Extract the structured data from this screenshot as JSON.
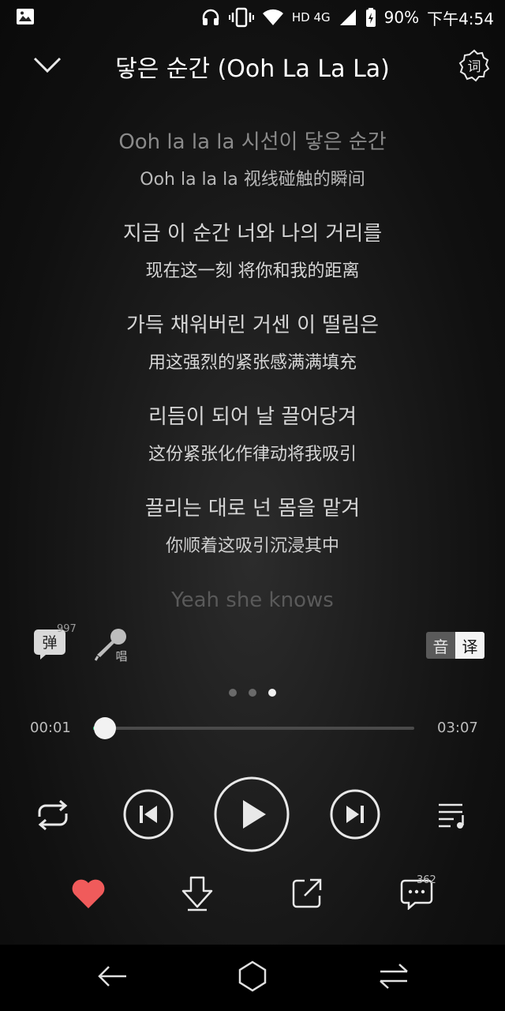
{
  "status_bar": {
    "hd_label": "HD 4G",
    "battery": "90%",
    "time": "下午4:54",
    "icons": [
      "gallery-icon",
      "headset-icon",
      "vibrate-icon",
      "wifi-icon",
      "signal-icon",
      "battery-charging-icon"
    ]
  },
  "header": {
    "title": "닿은 순간 (Ooh La La La)",
    "collapse_icon": "chevron-down-icon",
    "lyrics_mode_icon": "lyrics-settings-icon",
    "lyrics_mode_label": "词"
  },
  "lyrics": [
    {
      "primary": "Ooh la la la 시선이 닿은 순간",
      "secondary": "Ooh la la la 视线碰触的瞬间"
    },
    {
      "primary": "지금 이 순간 너와 나의 거리를",
      "secondary": "现在这一刻 将你和我的距离"
    },
    {
      "primary": "가득 채워버린 거센 이 떨림은",
      "secondary": "用这强烈的紧张感满满填充"
    },
    {
      "primary": "리듬이 되어 날 끌어당겨",
      "secondary": "这份紧张化作律动将我吸引"
    },
    {
      "primary": "끌리는 대로 넌 몸을 맡겨",
      "secondary": "你顺着这吸引沉浸其中"
    },
    {
      "primary": "Yeah she knows",
      "secondary": ""
    }
  ],
  "actions": {
    "danmaku_label": "弹",
    "danmaku_count": "997",
    "karaoke_label": "唱",
    "lang_original": "音",
    "lang_translation": "译"
  },
  "pager": {
    "count": 3,
    "active": 2
  },
  "progress": {
    "current": "00:01",
    "total": "03:07",
    "fraction": 0.005
  },
  "controls": {
    "repeat_icon": "repeat-icon",
    "prev_icon": "previous-track-icon",
    "play_icon": "play-icon",
    "next_icon": "next-track-icon",
    "playlist_icon": "playlist-icon"
  },
  "bottom_actions": {
    "like_icon": "heart-icon",
    "download_icon": "download-icon",
    "share_icon": "share-icon",
    "comment_icon": "comment-icon",
    "comment_count": "362"
  },
  "nav": {
    "back_icon": "back-arrow-icon",
    "home_icon": "home-icon",
    "recents_icon": "switch-apps-icon"
  },
  "colors": {
    "accent": "#31c27c",
    "like": "#f05b5b",
    "text_primary": "#ffffff",
    "text_muted": "#9a9a9a"
  }
}
